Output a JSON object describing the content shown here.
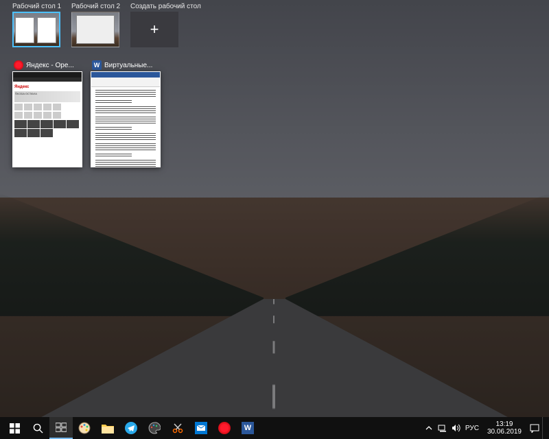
{
  "desktops": [
    {
      "label": "Рабочий стол 1",
      "active": true
    },
    {
      "label": "Рабочий стол 2",
      "active": false
    }
  ],
  "new_desktop_label": "Создать рабочий стол",
  "windows": [
    {
      "icon": "opera",
      "title": "Яндекс - Ope..."
    },
    {
      "icon": "word",
      "title": "Виртуальные..."
    }
  ],
  "opera_thumb": {
    "logo": "Яндекс",
    "banner": "ŠKODA OCTAVIA"
  },
  "taskbar": {
    "items": [
      {
        "name": "start",
        "icon": "windows"
      },
      {
        "name": "search",
        "icon": "search"
      },
      {
        "name": "task-view",
        "icon": "taskview",
        "active": true
      },
      {
        "name": "paint",
        "icon": "paint"
      },
      {
        "name": "explorer",
        "icon": "folder"
      },
      {
        "name": "telegram",
        "icon": "telegram"
      },
      {
        "name": "palette",
        "icon": "palette"
      },
      {
        "name": "snip",
        "icon": "snip"
      },
      {
        "name": "mail",
        "icon": "mail"
      },
      {
        "name": "opera",
        "icon": "opera"
      },
      {
        "name": "word",
        "icon": "word"
      }
    ]
  },
  "tray": {
    "lang": "РУС",
    "time": "13:19",
    "date": "30.06.2019"
  }
}
